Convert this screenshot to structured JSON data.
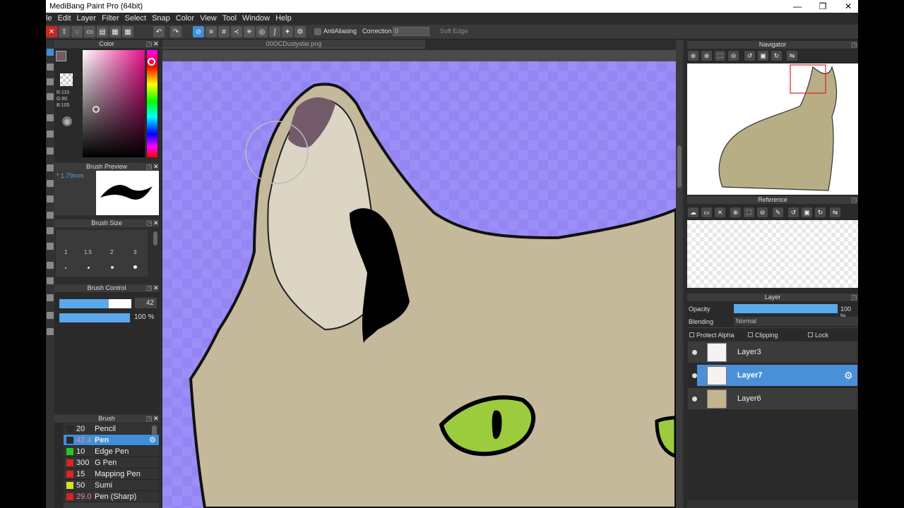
{
  "app": {
    "title": "MediBang Paint Pro (64bit)",
    "window_controls": {
      "minimize": "—",
      "maximize": "❐",
      "close": "✕"
    }
  },
  "menu": [
    "le",
    "Edit",
    "Layer",
    "Filter",
    "Select",
    "Snap",
    "Color",
    "View",
    "Tool",
    "Window",
    "Help"
  ],
  "toolbar": {
    "antialiasing_label": "AntiAliasing",
    "correction_label": "Correction",
    "correction_value": "0",
    "soft_edge_label": "Soft Edge"
  },
  "color_panel": {
    "title": "Color",
    "r": "R:115",
    "g": "G:90",
    "b": "B:105",
    "current_color": "#735a69"
  },
  "brush_preview": {
    "title": "Brush Preview",
    "size": "* 1.79mm"
  },
  "brush_size": {
    "title": "Brush Size",
    "sizes": [
      "1",
      "1.5",
      "2",
      "3"
    ]
  },
  "brush_control": {
    "title": "Brush Control",
    "size_value": "42",
    "opacity_value": "100 %"
  },
  "brush_panel": {
    "title": "Brush",
    "items": [
      {
        "size": "20",
        "name": "Pencil",
        "color": "#2a2a2a"
      },
      {
        "size": "42.4",
        "name": "Pen",
        "color": "#2a2a2a",
        "selected": true
      },
      {
        "size": "10",
        "name": "Edge Pen",
        "color": "#22cc22"
      },
      {
        "size": "300",
        "name": "G Pen",
        "color": "#dd2222"
      },
      {
        "size": "15",
        "name": "Mapping Pen",
        "color": "#dd2222"
      },
      {
        "size": "50",
        "name": "Sumi",
        "color": "#dddd22"
      },
      {
        "size": "29.0",
        "name": "Pen (Sharp)",
        "color": "#dd2222"
      }
    ]
  },
  "canvas": {
    "tab_title": "00OCDustystar.png"
  },
  "navigator": {
    "title": "Navigator"
  },
  "reference": {
    "title": "Reference"
  },
  "layer_panel": {
    "title": "Layer",
    "opacity_label": "Opacity",
    "opacity_value": "100 %",
    "opacity_fraction": 1.0,
    "blending_label": "Blending",
    "blending_value": "Normal",
    "protect_alpha": "Protect Alpha",
    "clipping": "Clipping",
    "lock": "Lock",
    "layers": [
      {
        "name": "Layer3"
      },
      {
        "name": "Layer7",
        "selected": true
      },
      {
        "name": "Layer6"
      }
    ]
  }
}
